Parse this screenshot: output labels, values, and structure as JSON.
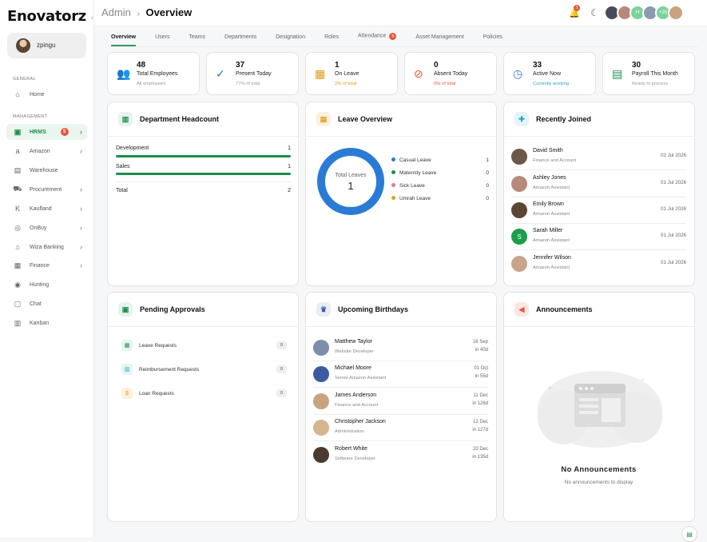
{
  "brand": {
    "logo_text": "Enovatorz",
    "collapse": "‹"
  },
  "user": {
    "name": "zpingu"
  },
  "sidebar": {
    "general_label": "GENERAL",
    "management_label": "MANAGEMENT",
    "home": "Home",
    "items": [
      {
        "label": "HRMS",
        "icon": "▣",
        "badge": "5",
        "chevron": "›"
      },
      {
        "label": "Amazon",
        "icon": "a",
        "chevron": "›"
      },
      {
        "label": "Warehouse",
        "icon": "▤"
      },
      {
        "label": "Procurement",
        "icon": "⛟",
        "chevron": "›"
      },
      {
        "label": "Kaufland",
        "icon": "K",
        "chevron": "›"
      },
      {
        "label": "OnBuy",
        "icon": "◎",
        "chevron": "›"
      },
      {
        "label": "Wiza Banking",
        "icon": "⌂",
        "chevron": "›"
      },
      {
        "label": "Finance",
        "icon": "▦",
        "chevron": "›"
      },
      {
        "label": "Hunting",
        "icon": "◉"
      },
      {
        "label": "Chat",
        "icon": "▢"
      },
      {
        "label": "Kanban",
        "icon": "▥"
      }
    ]
  },
  "header": {
    "crumb_root": "Admin",
    "separator": "›",
    "crumb_current": "Overview",
    "notifications": "3",
    "avatar_count": "+25",
    "avatar_h": "H"
  },
  "tabs": [
    {
      "label": "Overview"
    },
    {
      "label": "Users"
    },
    {
      "label": "Teams"
    },
    {
      "label": "Departments"
    },
    {
      "label": "Designation"
    },
    {
      "label": "Roles"
    },
    {
      "label": "Attendance",
      "badge": "5"
    },
    {
      "label": "Asset Management"
    },
    {
      "label": "Policies"
    }
  ],
  "stats": [
    {
      "value": "48",
      "label": "Total Employees",
      "sub": "All employees",
      "sub_color": "#999999",
      "icon": "👥",
      "icon_color": "#1b8f4a"
    },
    {
      "value": "37",
      "label": "Present Today",
      "sub": "77% of total",
      "sub_color": "#999999",
      "icon": "✓",
      "icon_color": "#2a7bd6"
    },
    {
      "value": "1",
      "label": "On Leave",
      "sub": "2% of total",
      "sub_color": "#e09a1a",
      "icon": "▦",
      "icon_color": "#e09a1a"
    },
    {
      "value": "0",
      "label": "Absent Today",
      "sub": "0% of total",
      "sub_color": "#e8563a",
      "icon": "⊘",
      "icon_color": "#e8563a"
    },
    {
      "value": "33",
      "label": "Active Now",
      "sub": "Currently working",
      "sub_color": "#2aa6c0",
      "icon": "◷",
      "icon_color": "#2a7bd6"
    },
    {
      "value": "30",
      "label": "Payroll This Month",
      "sub": "Ready to process",
      "sub_color": "#999999",
      "icon": "▤",
      "icon_color": "#1b8f4a"
    }
  ],
  "department": {
    "title": "Department Headcount",
    "rows": [
      {
        "name": "Development",
        "value": "1",
        "fill": 1.0
      },
      {
        "name": "Sales",
        "value": "1",
        "fill": 1.0
      }
    ],
    "total_label": "Total",
    "total_value": "2"
  },
  "leave": {
    "title": "Leave Overview",
    "center_label": "Total Leaves",
    "center_value": "1",
    "legend": [
      {
        "name": "Casual Leave",
        "value": "1",
        "color": "#2a7bd6"
      },
      {
        "name": "Maternity Leave",
        "value": "0",
        "color": "#1b8f4a"
      },
      {
        "name": "Sick Leave",
        "value": "0",
        "color": "#e8788a"
      },
      {
        "name": "Umrah Leave",
        "value": "0",
        "color": "#e0a21a"
      }
    ]
  },
  "recent": {
    "title": "Recently Joined",
    "people": [
      {
        "name": "David Smith",
        "role": "Finance and Account",
        "date": "02 Jul 2026",
        "color": "#6b5848"
      },
      {
        "name": "Ashley Jones",
        "role": "Amazon Assistant",
        "date": "01 Jul 2026",
        "color": "#b88978"
      },
      {
        "name": "Emily Brown",
        "role": "Amazon Assistant",
        "date": "01 Jul 2026",
        "color": "#5b4632"
      },
      {
        "name": "Sarah Miller",
        "role": "Amazon Assistant",
        "date": "01 Jul 2026",
        "color": "#1b9e4b",
        "initial": "S"
      },
      {
        "name": "Jennifer Wilson",
        "role": "Amazon Assistant",
        "date": "01 Jul 2026",
        "color": "#c9a48c"
      }
    ]
  },
  "approvals": {
    "title": "Pending Approvals",
    "items": [
      {
        "label": "Leave Requests",
        "count": "0",
        "color": "#1b8f4a",
        "bg": "#e6f4ec"
      },
      {
        "label": "Reimbursement Requests",
        "count": "0",
        "color": "#2aa6c0",
        "bg": "#e4f4f7"
      },
      {
        "label": "Loan Requests",
        "count": "0",
        "color": "#e0a21a",
        "bg": "#fbf1dc"
      }
    ]
  },
  "birthdays": {
    "title": "Upcoming Birthdays",
    "people": [
      {
        "name": "Matthew Taylor",
        "role": "Website Developer",
        "date": "16 Sep",
        "days": "in 40d",
        "color": "#7d8fa8"
      },
      {
        "name": "Michael Moore",
        "role": "Senior Amazon Assistant",
        "date": "01 Oct",
        "days": "in 55d",
        "color": "#3b5aa0"
      },
      {
        "name": "James Anderson",
        "role": "Finance and Account",
        "date": "11 Dec",
        "days": "in 126d",
        "color": "#c9a27e"
      },
      {
        "name": "Christopher Jackson",
        "role": "Administration",
        "date": "12 Dec",
        "days": "in 127d",
        "color": "#d8b48e"
      },
      {
        "name": "Robert White",
        "role": "Software Developer",
        "date": "20 Dec",
        "days": "in 135d",
        "color": "#4a3a30"
      }
    ]
  },
  "announcements": {
    "title": "Announcements",
    "empty_title": "No Announcements",
    "empty_sub": "No announcements to display"
  },
  "colors": {
    "accent": "#1b8f4a",
    "danger": "#e8563a"
  }
}
